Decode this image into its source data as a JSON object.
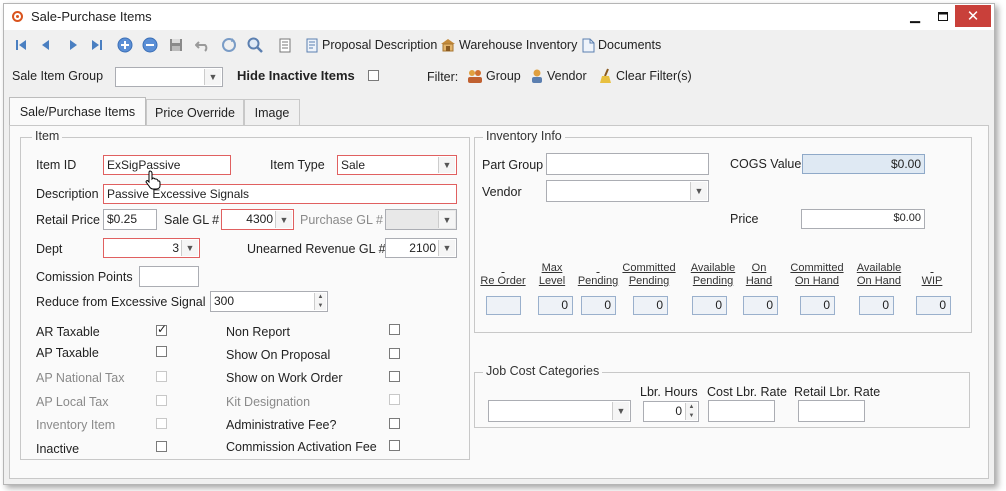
{
  "window": {
    "title": "Sale-Purchase Items"
  },
  "toolbar": {
    "proposal_description": "Proposal Description",
    "warehouse_inventory": "Warehouse Inventory",
    "documents": "Documents"
  },
  "filterbar": {
    "sale_item_group_label": "Sale Item Group",
    "sale_item_group_value": "",
    "hide_inactive_label": "Hide Inactive Items",
    "filter_label": "Filter:",
    "group": "Group",
    "vendor": "Vendor",
    "clear_filters": "Clear Filter(s)"
  },
  "tabs": [
    "Sale/Purchase Items",
    "Price Override",
    "Image"
  ],
  "item": {
    "legend": "Item",
    "item_id_label": "Item ID",
    "item_id": "ExSigPassive",
    "item_type_label": "Item Type",
    "item_type": "Sale",
    "description_label": "Description",
    "description": "Passive Excessive Signals",
    "retail_price_label": "Retail Price",
    "retail_price": "$0.25",
    "sale_gl_label": "Sale GL #",
    "sale_gl": "4300",
    "purchase_gl_label": "Purchase GL #",
    "purchase_gl": "",
    "dept_label": "Dept",
    "dept": "3",
    "unearned_label": "Unearned Revenue GL #",
    "unearned": "2100",
    "comission_label": "Comission Points",
    "comission": "",
    "reduce_label": "Reduce from Excessive Signal",
    "reduce": "300",
    "left_checks": [
      {
        "label": "AR Taxable",
        "checked": true,
        "disabled": false
      },
      {
        "label": "AP Taxable",
        "checked": false,
        "disabled": false
      },
      {
        "label": "AP National Tax",
        "checked": false,
        "disabled": true
      },
      {
        "label": "AP Local Tax",
        "checked": false,
        "disabled": true
      },
      {
        "label": "Inventory Item",
        "checked": false,
        "disabled": true
      },
      {
        "label": "Inactive",
        "checked": false,
        "disabled": false
      }
    ],
    "right_checks": [
      {
        "label": "Non Report",
        "checked": false,
        "disabled": false
      },
      {
        "label": "Show On Proposal",
        "checked": false,
        "disabled": false
      },
      {
        "label": "Show on Work Order",
        "checked": false,
        "disabled": false
      },
      {
        "label": "Kit Designation",
        "checked": false,
        "disabled": true
      },
      {
        "label": "Administrative Fee?",
        "checked": false,
        "disabled": false
      },
      {
        "label": "Commission Activation Fee",
        "checked": false,
        "disabled": false
      }
    ]
  },
  "inventory": {
    "legend": "Inventory Info",
    "part_group_label": "Part Group",
    "part_group": "",
    "vendor_label": "Vendor",
    "vendor": "",
    "cogs_label": "COGS Value",
    "cogs": "$0.00",
    "price_label": "Price",
    "price": "$0.00",
    "columns": [
      {
        "h1": "",
        "h2": "Re Order",
        "value": ""
      },
      {
        "h1": "Max",
        "h2": "Level",
        "value": "0"
      },
      {
        "h1": "",
        "h2": "Pending",
        "value": "0"
      },
      {
        "h1": "Committed",
        "h2": "Pending",
        "value": "0"
      },
      {
        "h1": "Available",
        "h2": "Pending",
        "value": "0"
      },
      {
        "h1": "On",
        "h2": "Hand",
        "value": "0"
      },
      {
        "h1": "Committed",
        "h2": "On Hand",
        "value": "0"
      },
      {
        "h1": "Available",
        "h2": "On Hand",
        "value": "0"
      },
      {
        "h1": "",
        "h2": "WIP",
        "value": "0"
      }
    ]
  },
  "jobcost": {
    "legend": "Job Cost Categories",
    "category": "",
    "lbr_hours_label": "Lbr. Hours",
    "lbr_hours": "0",
    "cost_rate_label": "Cost Lbr. Rate",
    "cost_rate": "",
    "retail_rate_label": "Retail Lbr. Rate",
    "retail_rate": ""
  }
}
